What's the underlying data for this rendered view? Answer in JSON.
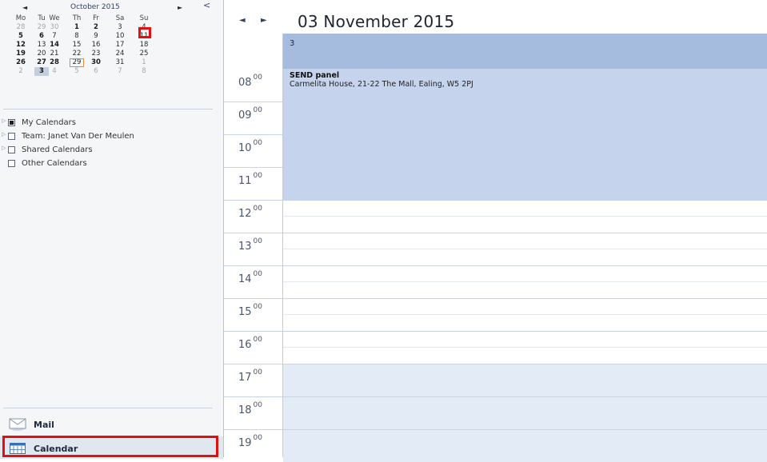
{
  "mini_calendar": {
    "prev_symbol": "◄",
    "next_symbol": "►",
    "month_label": "October 2015",
    "grip_symbol": "<",
    "weekdays": [
      "Mo",
      "Tu",
      "We",
      "Th",
      "Fr",
      "Sa",
      "Su"
    ],
    "weeks": [
      [
        "28",
        "29",
        "30",
        "1",
        "2",
        "3",
        "4"
      ],
      [
        "5",
        "6",
        "7",
        "8",
        "9",
        "10",
        "11"
      ],
      [
        "12",
        "13",
        "14",
        "15",
        "16",
        "17",
        "18"
      ],
      [
        "19",
        "20",
        "21",
        "22",
        "23",
        "24",
        "25"
      ],
      [
        "26",
        "27",
        "28",
        "29",
        "30",
        "31",
        "1"
      ],
      [
        "2",
        "3",
        "4",
        "5",
        "6",
        "7",
        "8"
      ]
    ]
  },
  "calendars": [
    {
      "label": "My Calendars",
      "checked": true
    },
    {
      "label": "Team: Janet Van Der Meulen",
      "checked": false
    },
    {
      "label": "Shared Calendars",
      "checked": false
    },
    {
      "label": "Other Calendars",
      "checked": false
    }
  ],
  "nav_buttons": {
    "mail_label": "Mail",
    "calendar_label": "Calendar"
  },
  "day_view": {
    "prev_symbol": "◄",
    "next_symbol": "►",
    "title": "03 November 2015",
    "column_day": "3",
    "hours": [
      "08",
      "09",
      "10",
      "11",
      "12",
      "13",
      "14",
      "15",
      "16",
      "17",
      "18",
      "19"
    ],
    "minutes": "00",
    "event": {
      "title": "SEND panel",
      "location": "Carmelita House, 21-22 The Mall, Ealing, W5 2PJ",
      "color": "#c5d3ec"
    }
  },
  "colors": {
    "highlight_box": "#e10f0f",
    "header_bar": "#a6bcdf"
  }
}
